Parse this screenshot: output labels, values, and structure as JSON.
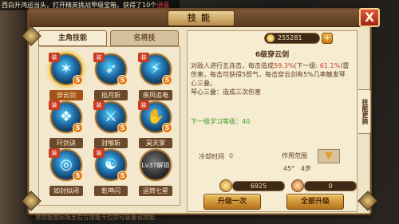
{
  "ticker": {
    "before": "西白升鸿运当头，打开精英挑战甲级宝箱，获得了10个",
    "highlight": "逍遥"
  },
  "panel": {
    "title": "技能",
    "close_label": "X"
  },
  "tabs": {
    "active": "主角技能",
    "inactive": "名将技"
  },
  "skills": [
    {
      "name": "穿云剑",
      "level": "5",
      "badge": "装",
      "glyph": "✶",
      "selected": true
    },
    {
      "name": "掐月斩",
      "level": "5",
      "badge": "装",
      "glyph": "➶",
      "selected": false
    },
    {
      "name": "疾风追电",
      "level": "5",
      "badge": "装",
      "glyph": "⚡",
      "selected": false
    },
    {
      "name": "玕剑诀",
      "level": "5",
      "badge": "装",
      "glyph": "❖",
      "selected": false
    },
    {
      "name": "封喉斩",
      "level": "5",
      "badge": "装",
      "glyph": "⚔",
      "selected": false
    },
    {
      "name": "昊天掌",
      "level": "5",
      "badge": "装",
      "glyph": "✋",
      "selected": false
    },
    {
      "name": "如封似闭",
      "level": "5",
      "badge": "装",
      "glyph": "◎",
      "selected": false
    },
    {
      "name": "乾坤闪",
      "level": "5",
      "badge": "装",
      "glyph": "☯",
      "selected": false
    },
    {
      "name": "运转七星",
      "level": "",
      "badge": "",
      "glyph": "",
      "selected": false,
      "lock_text": "Lv37解锁"
    }
  ],
  "hint": "将技能图标拖至右方技能卡位即可装备该技能",
  "currency": {
    "amount": "255281",
    "plus": "+"
  },
  "detail": {
    "title": "6级穿云剑",
    "desc_1": "对敌人进行五连击，每击造成",
    "pct": "59.3%",
    "desc_2": "(下一级: ",
    "next_pct": "61.1%",
    "desc_3": ")雷伤害，每击可获得5怒气，每击穿云剑有5%几率触发琴心三叠。",
    "desc_4": "琴心三叠：造成三次伤害",
    "next_level_label": "下一级学习等级：40",
    "cd_label": "冷却时间",
    "cd_value": "0",
    "range_label": "作用范围",
    "range_angle": "45°",
    "range_steps": "4步"
  },
  "side_tab": "技能更换",
  "costs": {
    "gold": "6925",
    "other": "0"
  },
  "buttons": {
    "upgrade_once": "升级一次",
    "upgrade_all": "全部升级"
  }
}
